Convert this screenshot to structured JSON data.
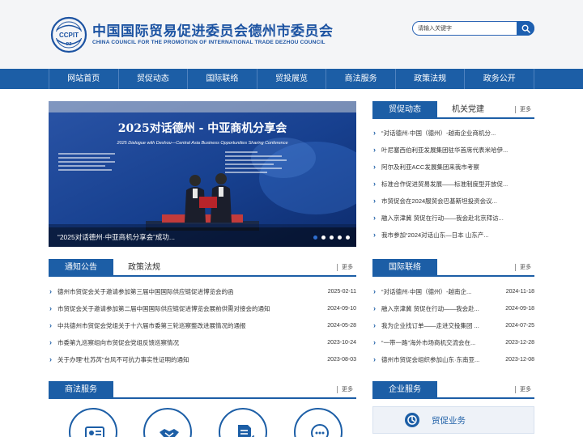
{
  "header": {
    "logo_text": "CCPIT",
    "logo_sub": "DZ",
    "title_cn": "中国国际贸易促进委员会德州市委员会",
    "title_en": "CHINA COUNCIL FOR THE PROMOTION OF INTERNATIONAL TRADE DEZHOU COUNCIL",
    "search_placeholder": "请输入关键字"
  },
  "nav": [
    "网站首页",
    "贸促动态",
    "国际联络",
    "贸投展览",
    "商法服务",
    "政策法规",
    "政务公开"
  ],
  "banner": {
    "headline": "2025对话德州 - 中亚商机分享会",
    "headline_en": "2025 Dialogue with Deshou—Central Asia Business Opportunities Sharing Conference",
    "caption": "“2025对话德州·中亚商机分享会”成功...",
    "slide_count": 5,
    "active_slide": 0
  },
  "trade_news": {
    "tab_active": "贸促动态",
    "tab_other": "机关党建",
    "more": "更多",
    "items": [
      "“对话德州·中国（德州）-越南企业商机分...",
      "叶尼塞西伯利亚发展集团驻华首席代表米哈伊...",
      "阿尔及利亚ACC发展集团来我市考察",
      "标准合作促进贸易发展——标准制度型开放促...",
      "市贸促会在2024服贸会巴基斯坦投资会议...",
      "融入京津冀 贸促在行动——我会赴北京拜访...",
      "我市参加“2024对话山东—日本 山东产..."
    ]
  },
  "notices": {
    "tab_active": "通知公告",
    "tab_other": "政策法规",
    "more": "更多",
    "items": [
      {
        "title": "德州市贸促会关于邀请参加第三届中国国际供应链促进博览会的函",
        "date": "2025-02-11"
      },
      {
        "title": "市贸促会关于邀请参加第二届中国国际供应链促进博览会展前供需对接会的通知",
        "date": "2024-09-10"
      },
      {
        "title": "中共德州市贸促会党组关于十六届市委第三轮巡察整改进展情况的通报",
        "date": "2024-05-28"
      },
      {
        "title": "市委第九巡察组向市贸促会党组反馈巡察情况",
        "date": "2023-10-24"
      },
      {
        "title": "关于办理“杜苏芮”台风不可抗力事实性证明的通知",
        "date": "2023-08-03"
      }
    ]
  },
  "intl": {
    "tab_active": "国际联络",
    "more": "更多",
    "items": [
      {
        "title": "“对话德州·中国（德州）-越南企...",
        "date": "2024-11-18"
      },
      {
        "title": "融入京津冀 贸促在行动——我会赴...",
        "date": "2024-09-18"
      },
      {
        "title": "我为企业找订单——走进交投集团 ...",
        "date": "2024-07-25"
      },
      {
        "title": "“一带一路”海外市场商机交流会在...",
        "date": "2023-12-28"
      },
      {
        "title": "德州市贸促会组织参加山东·东南亚...",
        "date": "2023-12-08"
      }
    ]
  },
  "legal": {
    "tab_active": "商法服务",
    "more": "更多",
    "icons": [
      "certificate-icon",
      "handshake-icon",
      "document-edit-icon",
      "consult-chat-icon"
    ]
  },
  "enterprise": {
    "tab_active": "企业服务",
    "more": "更多",
    "box_label": "贸促业务"
  },
  "colors": {
    "primary": "#1c5ea6",
    "header_bg": "#f4f5f7",
    "nav_divider": "#4f82bf"
  }
}
